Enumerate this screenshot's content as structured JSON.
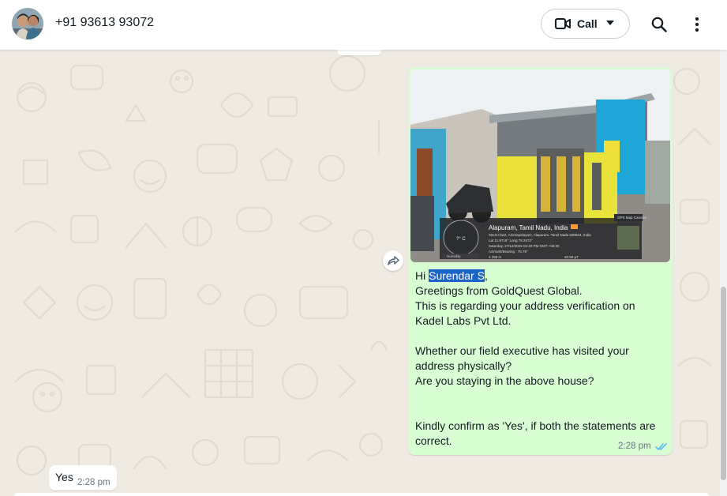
{
  "header": {
    "contact_name": "+91 93613 93072",
    "call_label": "Call"
  },
  "message_out": {
    "greeting_prefix": "Hi ",
    "highlighted_name": "Surendar S",
    "greeting_suffix": ",",
    "body": "Greetings from GoldQuest Global.\nThis is regarding your address verification on Kadel Labs Pvt Ltd.\n\nWhether our field executive has visited your address physically?\nAre you staying in the above house?\n\n\nKindly confirm as 'Yes', if both the statements are correct.",
    "time": "2:28 pm",
    "status_color": "#53bdeb",
    "photo": {
      "location": "Alapuram, Tamil Nadu, India",
      "address": "X9cm+bw2, Ammapalayam, Alapuram, Tamil Nadu 636924, India",
      "coords": "Lat 11.9718° Long 78.2672°",
      "datetime": "Saturday, 27/12/2025 02:29 PM GMT +05:30",
      "azimuth": "Azimuth/Bearing : 76.75°",
      "temperature": "?° C",
      "humidity": "Humidity",
      "altitude": "4 358 m",
      "magnetic": "40.58 µT",
      "badge": "GPS Map Camera"
    }
  },
  "message_in": {
    "text": "Yes",
    "time": "2:28 pm"
  },
  "colors": {
    "outgoing_bubble": "#d9fdd3",
    "incoming_bubble": "#ffffff",
    "chat_bg": "#efeae2",
    "highlight": "#1c63c9"
  }
}
